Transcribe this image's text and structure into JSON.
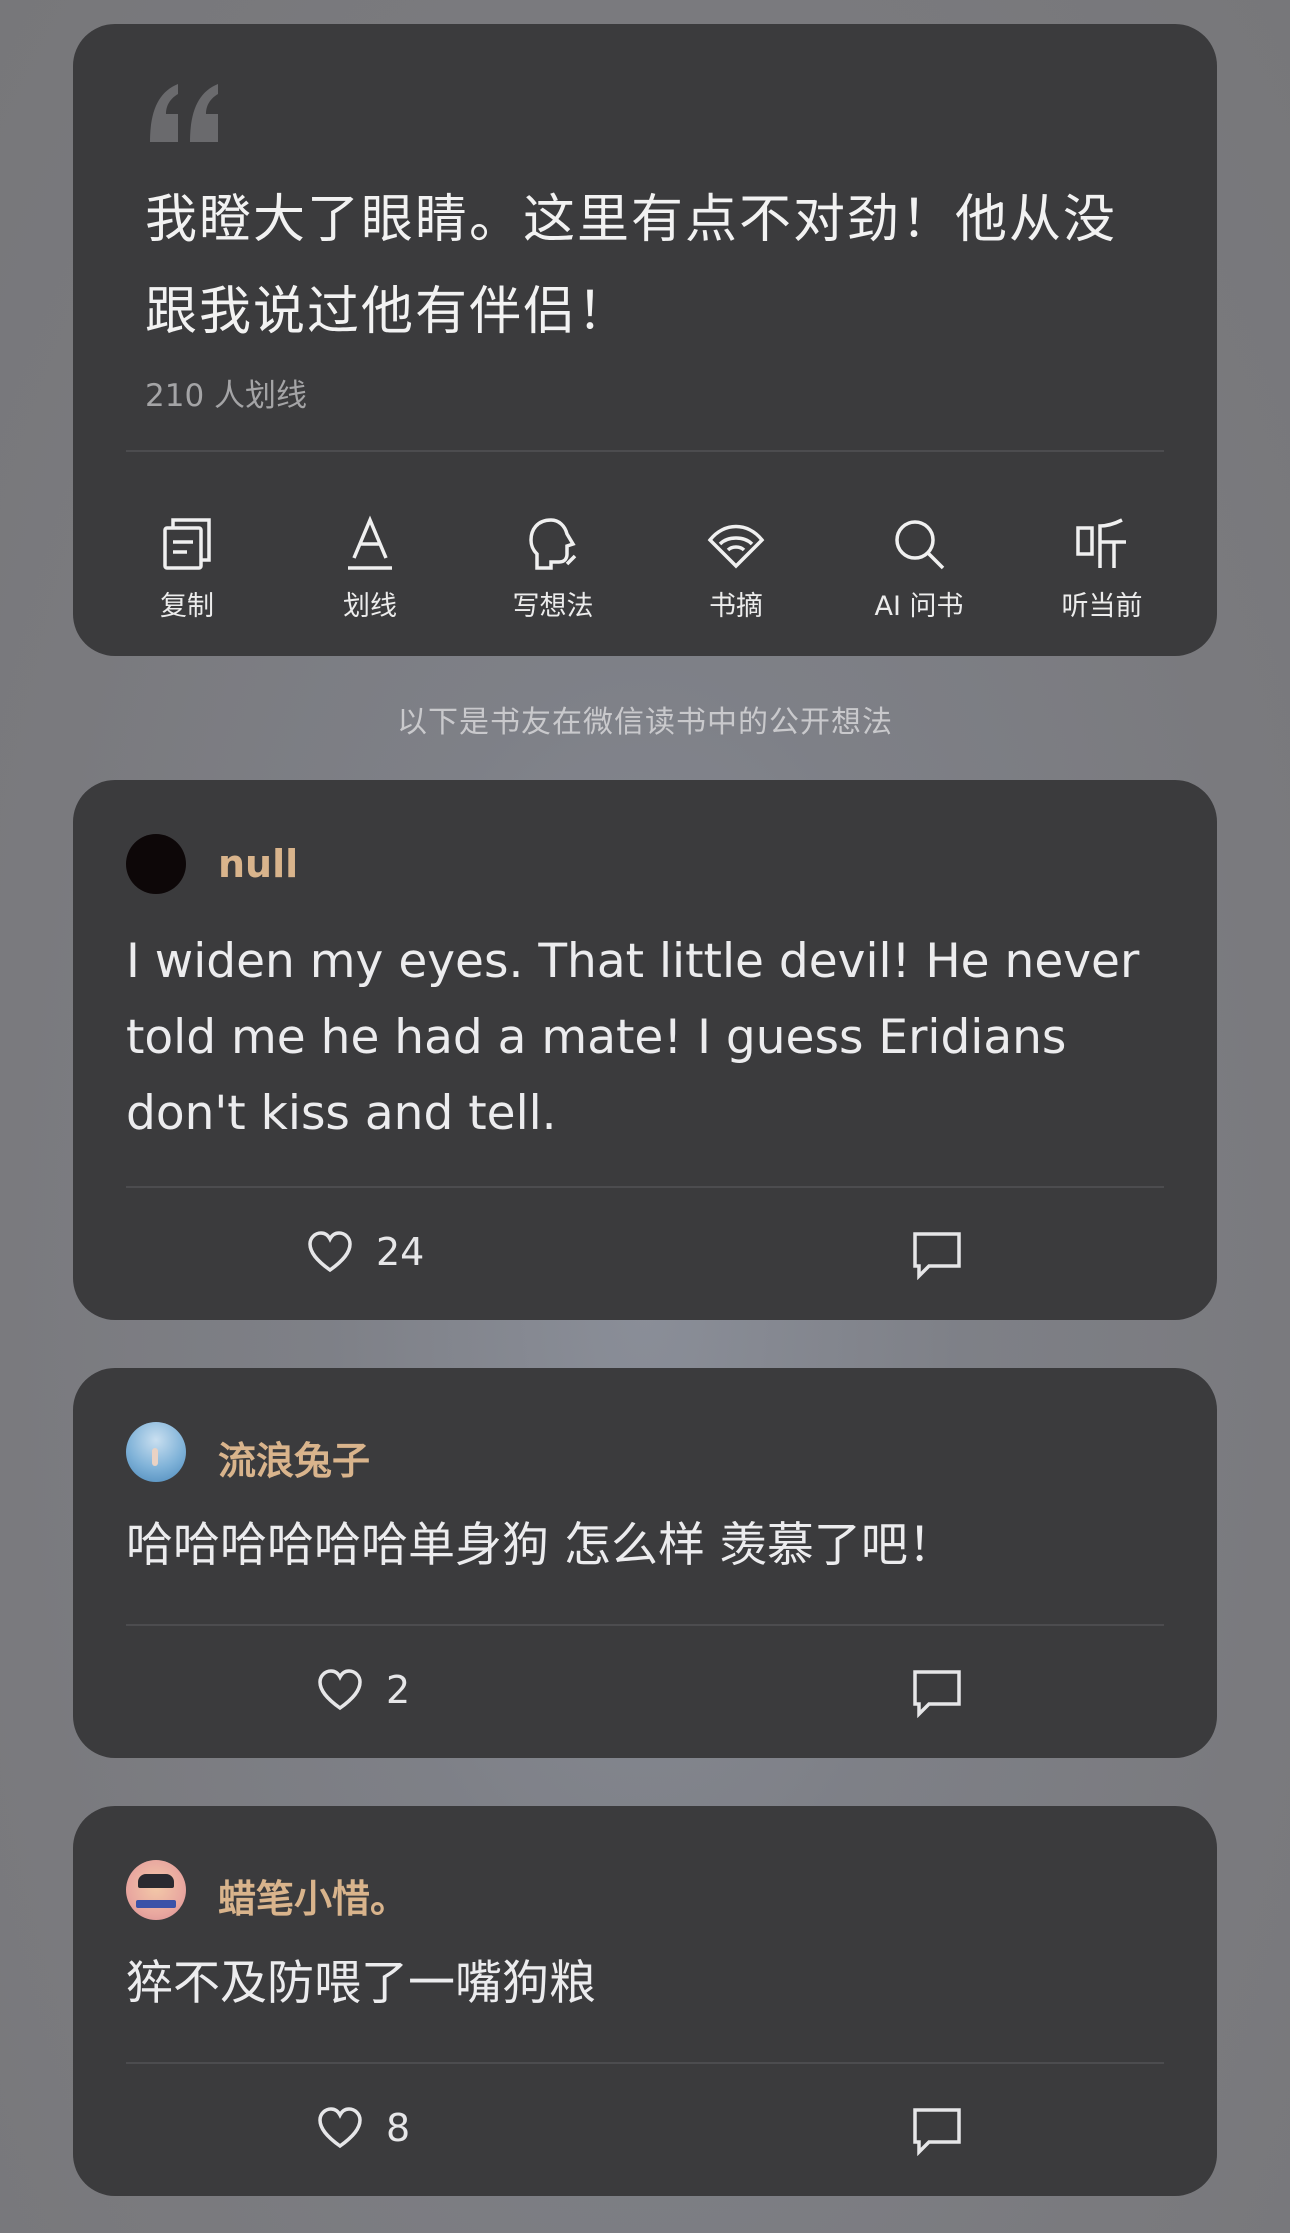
{
  "quote": {
    "text": "我瞪大了眼睛。这里有点不对劲！他从没跟我说过他有伴侣！",
    "count_label": "210 人划线"
  },
  "actions": [
    {
      "label": "复制",
      "icon": "copy-icon"
    },
    {
      "label": "划线",
      "icon": "underline-icon"
    },
    {
      "label": "写想法",
      "icon": "thought-icon"
    },
    {
      "label": "书摘",
      "icon": "fan-icon"
    },
    {
      "label": "AI 问书",
      "icon": "search-icon"
    },
    {
      "label": "听当前",
      "icon": "listen-icon"
    }
  ],
  "section_hint": "以下是书友在微信读书中的公开想法",
  "comments": [
    {
      "user": "null",
      "text": "I widen my eyes. That little devil! He never told me he had a mate! I guess Eridians don't kiss and tell.",
      "likes": "24"
    },
    {
      "user": "流浪兔子",
      "text": "哈哈哈哈哈哈单身狗 怎么样 羡慕了吧！",
      "likes": "2"
    },
    {
      "user": "蜡笔小惜。",
      "text": "猝不及防喂了一嘴狗粮",
      "likes": "8"
    }
  ],
  "colors": {
    "card": "#3b3b3d",
    "username": "#d9b48c",
    "background": "#7c7d82"
  }
}
